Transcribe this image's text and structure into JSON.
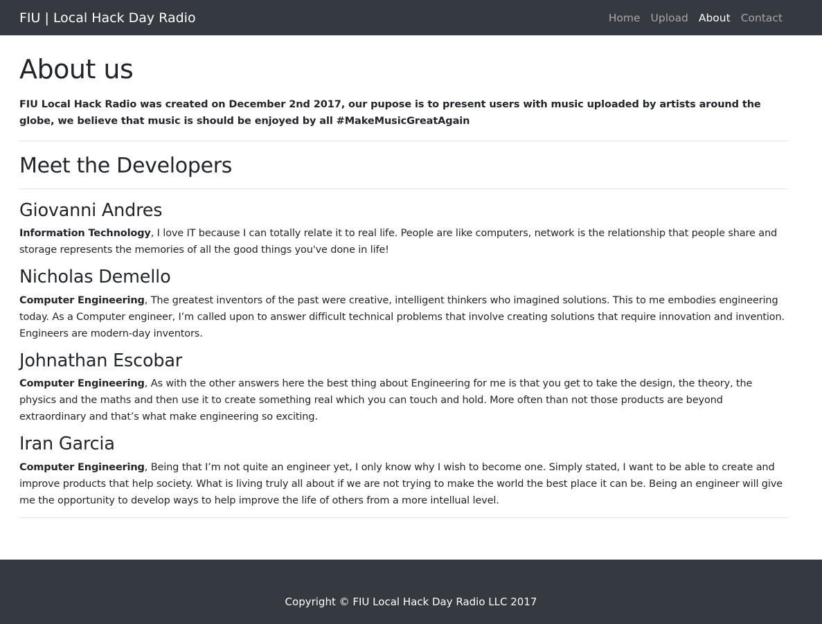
{
  "navbar": {
    "brand": "FIU | Local Hack Day Radio",
    "links": [
      {
        "label": "Home",
        "active": false
      },
      {
        "label": "Upload",
        "active": false
      },
      {
        "label": "About",
        "active": true
      },
      {
        "label": "Contact",
        "active": false
      }
    ]
  },
  "main": {
    "title": "About us",
    "intro": "FIU Local Hack Radio was created on December 2nd 2017, our pupose is to present users with music uploaded by artists around the globe, we believe that music is should be enjoyed by all #MakeMusicGreatAgain",
    "developers_heading": "Meet the Developers",
    "developers": [
      {
        "name": "Giovanni Andres",
        "major": "Information Technology",
        "bio": ", I love IT because I can totally relate it to real life. People are like computers, network is the relationship that people share and storage represents the memories of all the good things you've done in life!"
      },
      {
        "name": "Nicholas Demello",
        "major": "Computer Engineering",
        "bio": ", The greatest inventors of the past were creative, intelligent thinkers who imagined solutions. This to me embodies engineering today. As a Computer engineer, I’m called upon to answer difficult technical problems that involve creating solutions that require innovation and invention. Engineers are modern-day inventors."
      },
      {
        "name": "Johnathan Escobar",
        "major": "Computer Engineering",
        "bio": ", As with the other answers here the best thing about Engineering for me is that you get to take the design, the theory, the physics and the maths and then use it to create something real which you can touch and hold. More often than not those products are beyond extraordinary and that’s what make engineering so exciting."
      },
      {
        "name": "Iran Garcia",
        "major": "Computer Engineering",
        "bio": ", Being that I’m not quite an engineer yet, I only know why I wish to become one. Simply stated, I want to be able to create and improve products that help society. What is living truly all about if we are not trying to make the world the best place it can be. Being an engineer will give me the opportunity to develop ways to help improve the life of others from a more intellual level."
      }
    ]
  },
  "footer": {
    "copyright": "Copyright © FIU Local Hack Day Radio LLC 2017"
  },
  "colors": {
    "navbar_bg": "#343a40",
    "text": "#212529",
    "nav_inactive": "rgba(255,255,255,0.55)",
    "nav_active": "#ffffff"
  }
}
